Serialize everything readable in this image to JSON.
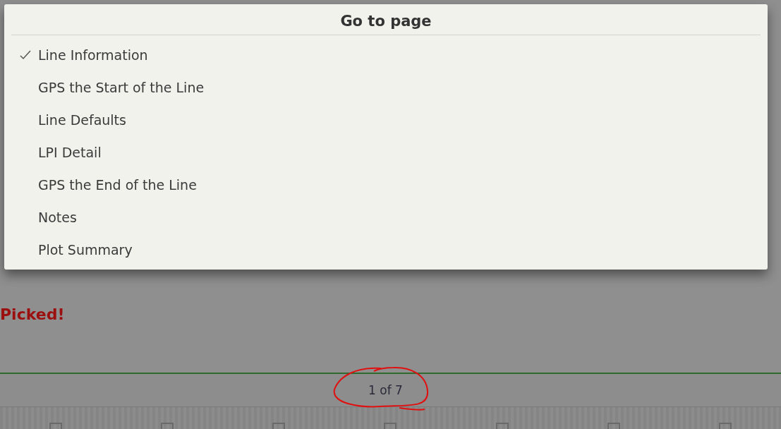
{
  "background": {
    "message": "Picked!",
    "pager": "1 of 7"
  },
  "dialog": {
    "title": "Go to page",
    "items": [
      {
        "label": "Line Information",
        "selected": true
      },
      {
        "label": "GPS the Start of the Line",
        "selected": false
      },
      {
        "label": "Line Defaults",
        "selected": false
      },
      {
        "label": "LPI Detail",
        "selected": false
      },
      {
        "label": "GPS the End of the Line",
        "selected": false
      },
      {
        "label": "Notes",
        "selected": false
      },
      {
        "label": "Plot Summary",
        "selected": false
      }
    ]
  }
}
